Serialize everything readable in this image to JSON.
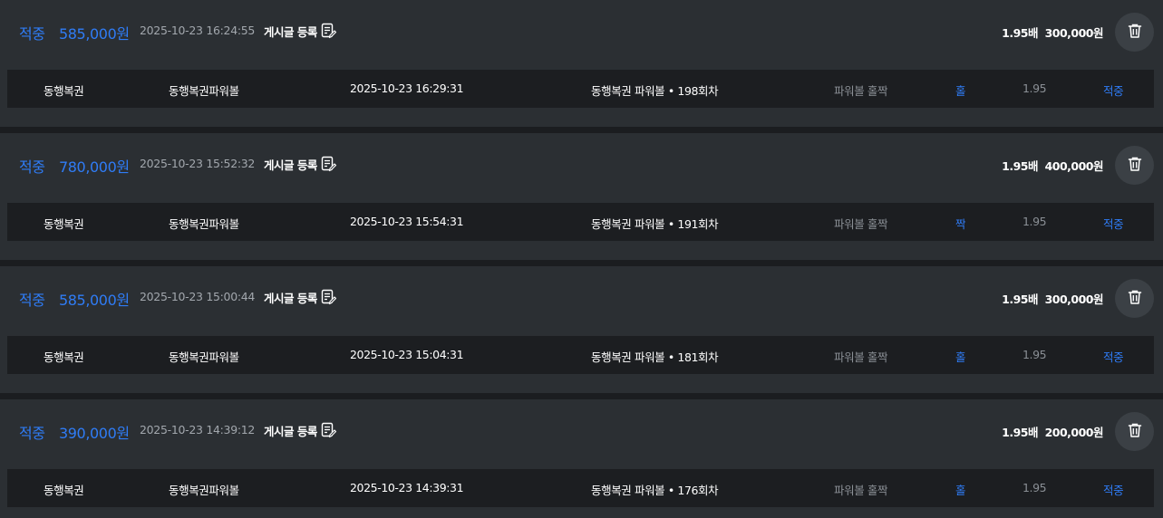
{
  "bets": [
    {
      "status": "적중",
      "payout": "585,000원",
      "datetime": "2025-10-23 16:24:55",
      "post_label": "게시글 등록",
      "odds": "1.95배",
      "stake": "300,000원",
      "detail": {
        "lottery": "동행복권",
        "game": "동행복권파워볼",
        "draw_time": "2025-10-23 16:29:31",
        "round": "동행복권 파워볼 • 198회차",
        "market": "파워볼 홀짝",
        "pick": "홀",
        "rate": "1.95",
        "result": "적중"
      }
    },
    {
      "status": "적중",
      "payout": "780,000원",
      "datetime": "2025-10-23 15:52:32",
      "post_label": "게시글 등록",
      "odds": "1.95배",
      "stake": "400,000원",
      "detail": {
        "lottery": "동행복권",
        "game": "동행복권파워볼",
        "draw_time": "2025-10-23 15:54:31",
        "round": "동행복권 파워볼 • 191회차",
        "market": "파워볼 홀짝",
        "pick": "짝",
        "rate": "1.95",
        "result": "적중"
      }
    },
    {
      "status": "적중",
      "payout": "585,000원",
      "datetime": "2025-10-23 15:00:44",
      "post_label": "게시글 등록",
      "odds": "1.95배",
      "stake": "300,000원",
      "detail": {
        "lottery": "동행복권",
        "game": "동행복권파워볼",
        "draw_time": "2025-10-23 15:04:31",
        "round": "동행복권 파워볼 • 181회차",
        "market": "파워볼 홀짝",
        "pick": "홀",
        "rate": "1.95",
        "result": "적중"
      }
    },
    {
      "status": "적중",
      "payout": "390,000원",
      "datetime": "2025-10-23 14:39:12",
      "post_label": "게시글 등록",
      "odds": "1.95배",
      "stake": "200,000원",
      "detail": {
        "lottery": "동행복권",
        "game": "동행복권파워볼",
        "draw_time": "2025-10-23 14:39:31",
        "round": "동행복권 파워볼 • 176회차",
        "market": "파워볼 홀짝",
        "pick": "홀",
        "rate": "1.95",
        "result": "적중"
      }
    }
  ],
  "icons": {
    "post": "document-edit-icon",
    "delete": "trash-icon"
  },
  "colors": {
    "accent": "#2f7cf6",
    "card_bg": "#2b2f33",
    "row_bg": "#1c1e21",
    "page_bg": "#1b1d20"
  }
}
